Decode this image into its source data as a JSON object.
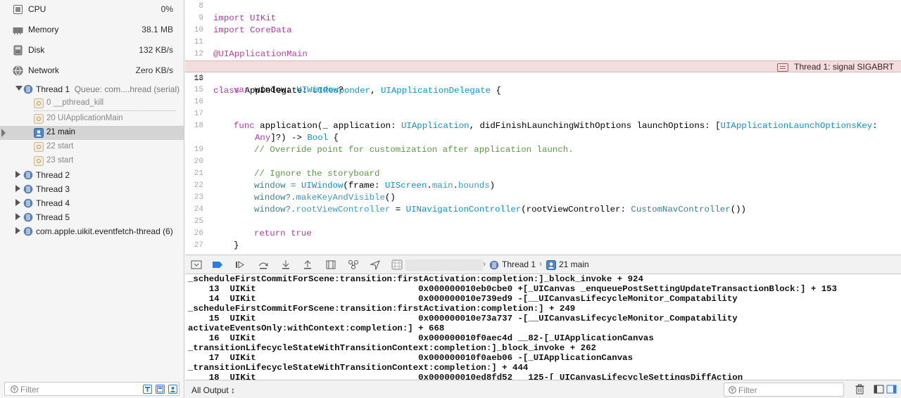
{
  "gauges": [
    {
      "label": "CPU",
      "value": "0%",
      "icon": "cpu-icon"
    },
    {
      "label": "Memory",
      "value": "38.1 MB",
      "icon": "memory-icon"
    },
    {
      "label": "Disk",
      "value": "132 KB/s",
      "icon": "disk-icon"
    },
    {
      "label": "Network",
      "value": "Zero KB/s",
      "icon": "network-icon"
    }
  ],
  "thread1": {
    "label": "Thread 1",
    "queue": "Queue: com....hread (serial)",
    "frames": [
      {
        "label": "0 __pthread_kill"
      },
      {
        "label": "20 UIApplicationMain"
      },
      {
        "label": "21 main"
      },
      {
        "label": "22 start"
      },
      {
        "label": "23 start"
      }
    ]
  },
  "threads": [
    {
      "label": "Thread 2"
    },
    {
      "label": "Thread 3"
    },
    {
      "label": "Thread 4"
    },
    {
      "label": "Thread 5"
    },
    {
      "label": "com.apple.uikit.eventfetch-thread (6)"
    }
  ],
  "nav_filter": {
    "placeholder": "Filter"
  },
  "editor": {
    "line_numbers": [
      "8",
      "9",
      "10",
      "11",
      "12",
      "13",
      "14",
      "15",
      "16",
      "17",
      "18",
      "",
      "19",
      "20",
      "21",
      "22",
      "23",
      "24",
      "25",
      "26",
      "27"
    ],
    "error_line": "13",
    "error_message": "Thread 1: signal SIGABRT",
    "code": {
      "l9": "import UIKit",
      "l10": "import CoreData",
      "l12": "@UIApplicationMain",
      "l13_kw": "class",
      "l13_name": " AppDelegate: ",
      "l13_t1": "UIResponder",
      "l13_sep": ", ",
      "l13_t2": "UIApplicationDelegate",
      "l13_end": " {",
      "l15_kw": "var",
      "l15_a": " window: ",
      "l15_t": "UIWindow",
      "l15_end": "?",
      "l18_kw": "func",
      "l18_a": " application(_ application: ",
      "l18_t1": "UIApplication",
      "l18_b": ", didFinishLaunchingWithOptions launchOptions: [",
      "l18_t2": "UIApplicationLaunchOptionsKey",
      "l18_c": ":",
      "l18w_t": "Any",
      "l18w_a": "]?) -> ",
      "l18w_t2": "Bool",
      "l18w_end": " {",
      "l19": "// Override point for customization after application launch.",
      "l21": "// Ignore the storyboard",
      "l22_a": "window = ",
      "l22_t": "UIWindow",
      "l22_b": "(frame: ",
      "l22_t2": "UIScreen",
      "l22_c": ".",
      "l22_p1": "main",
      "l22_d": ".",
      "l22_p2": "bounds",
      "l22_end": ")",
      "l23_a": "window?.",
      "l23_p": "makeKeyAndVisible",
      "l23_end": "()",
      "l24_a": "window?.",
      "l24_p": "rootViewController",
      "l24_b": " = ",
      "l24_t": "UINavigationController",
      "l24_c": "(rootViewController: ",
      "l24_t2": "CustomNavController",
      "l24_end": "())",
      "l26_kw": "return",
      "l26_a": " ",
      "l26_kw2": "true",
      "l27": "}"
    }
  },
  "debugbar": {
    "crumb_thread": "Thread 1",
    "crumb_frame": "21 main"
  },
  "console": {
    "lines": [
      "_scheduleFirstCommitForScene:transition:firstActivation:completion:]_block_invoke + 924",
      "    13  UIKit                               0x000000010eb0cbe0 +[_UICanvas _enqueuePostSettingUpdateTransactionBlock:] + 153",
      "    14  UIKit                               0x000000010e739ed9 -[__UICanvasLifecycleMonitor_Compatability",
      "_scheduleFirstCommitForScene:transition:firstActivation:completion:] + 249",
      "    15  UIKit                               0x000000010e73a737 -[__UICanvasLifecycleMonitor_Compatability",
      "activateEventsOnly:withContext:completion:] + 668",
      "    16  UIKit                               0x000000010f0aec4d __82-[_UIApplicationCanvas",
      "_transitionLifecycleStateWithTransitionContext:completion:]_block_invoke + 262",
      "    17  UIKit                               0x000000010f0aeb06 -[_UIApplicationCanvas",
      "_transitionLifecycleStateWithTransitionContext:completion:] + 444",
      "    18  UIKit                               0x000000010ed8fd52 __125-[_UICanvasLifecycleSettingsDiffAction"
    ]
  },
  "bottombar": {
    "output_label": "All Output ↕",
    "filter_placeholder": "Filter"
  },
  "colors": {
    "accent": "#2b7de0",
    "error_line_bg": "#f2dede",
    "keyword": "#ad3da4",
    "type": "#0e92c7",
    "comment": "#5d9a44"
  }
}
